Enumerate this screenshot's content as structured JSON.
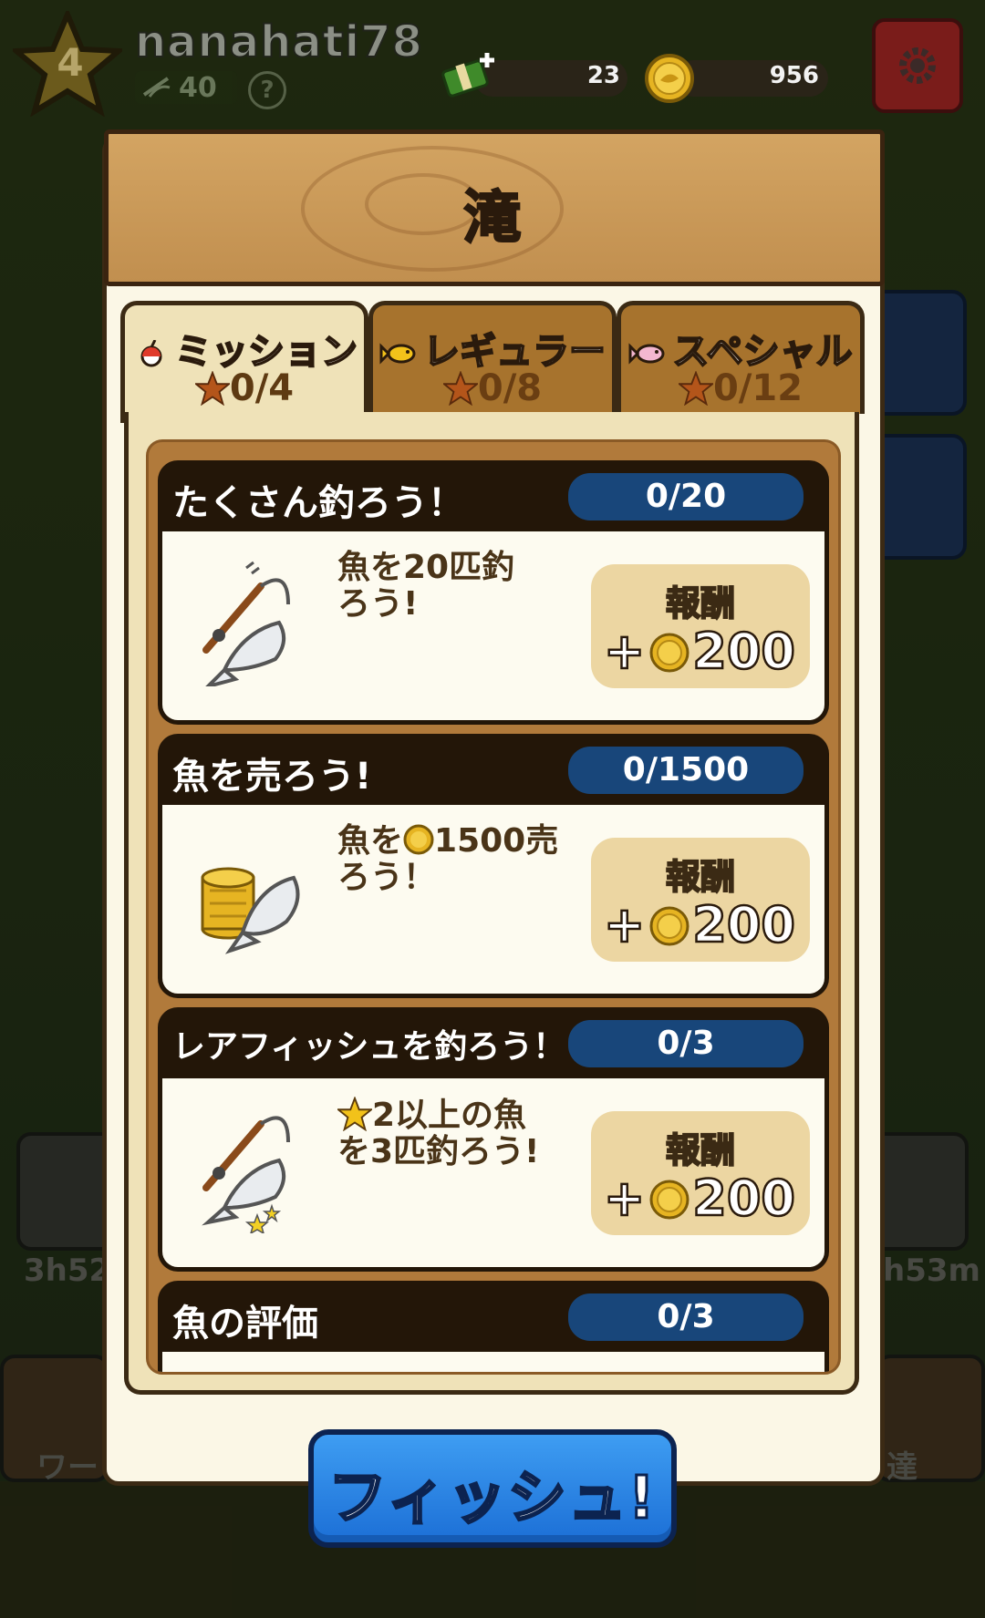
{
  "player": {
    "level": "4",
    "username": "nanahati78",
    "rank": "40",
    "help": "?"
  },
  "currency": {
    "cash": "23",
    "coins": "956"
  },
  "panel": {
    "title": "滝"
  },
  "tabs": [
    {
      "label": "ミッション",
      "count": "0/4",
      "icon": "bobber-icon",
      "active": true
    },
    {
      "label": "レギュラー",
      "count": "0/8",
      "icon": "yellow-fish-icon",
      "active": false
    },
    {
      "label": "スペシャル",
      "count": "0/12",
      "icon": "pink-fish-icon",
      "active": false
    }
  ],
  "missions": [
    {
      "title": "たくさん釣ろう！",
      "progress": "0/20",
      "desc_a": "魚を20匹釣",
      "desc_b": "ろう!",
      "reward_label": "報酬",
      "reward_amount": "200",
      "icon": "fishing-rod-fish-icon"
    },
    {
      "title": "魚を売ろう!",
      "progress": "0/1500",
      "desc_a": "魚を",
      "desc_a2": "1500売",
      "desc_b": "ろう！",
      "reward_label": "報酬",
      "reward_amount": "200",
      "icon": "coin-stack-fish-icon"
    },
    {
      "title": "レアフィッシュを釣ろう！",
      "progress": "0/3",
      "desc_a": "2以上の魚",
      "desc_b": "を3匹釣ろう!",
      "reward_label": "報酬",
      "reward_amount": "200",
      "icon": "fishing-rod-rare-fish-icon"
    },
    {
      "title": "魚の評価",
      "progress": "0/3"
    }
  ],
  "background": {
    "timer_left": "3h52",
    "timer_right": "h53m",
    "label_left": "ワー",
    "label_right": "達"
  },
  "fish_button": {
    "label": "フィッシュ!"
  },
  "colors": {
    "progress_pill": "#18467a",
    "fish_button": "#2f86e6",
    "card_header": "#231608",
    "wood": "#c99857"
  }
}
